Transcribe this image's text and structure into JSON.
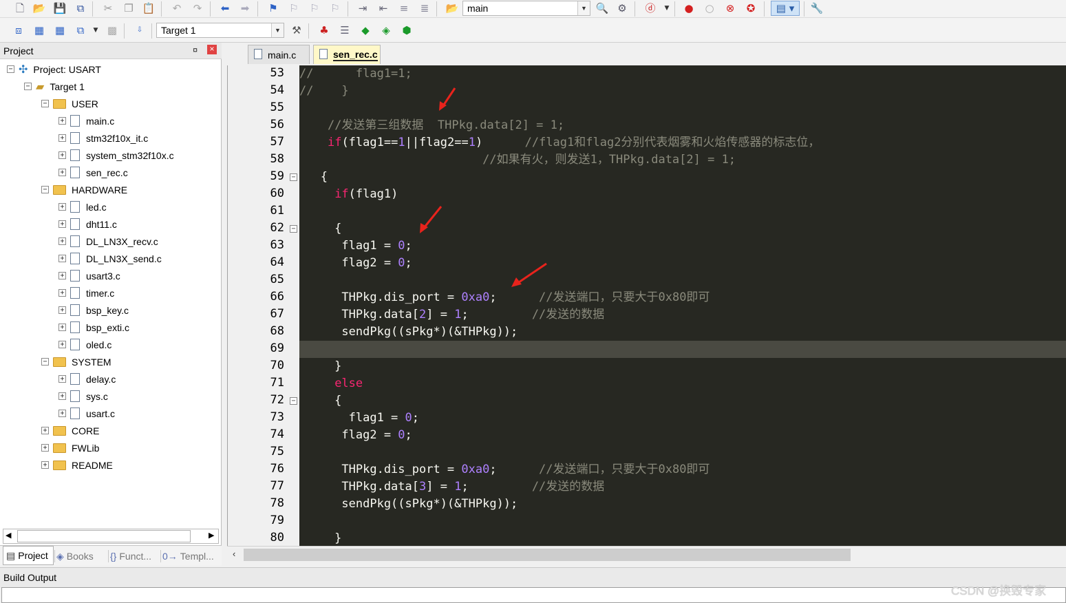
{
  "toolbar": {
    "file_combo": "main",
    "target_combo": "Target 1",
    "icons": [
      "new-file-icon",
      "open-file-icon",
      "save-icon",
      "save-all-icon",
      "cut-icon",
      "copy-icon",
      "paste-icon",
      "undo-icon",
      "redo-icon",
      "nav-back-icon",
      "nav-forward-icon",
      "bookmark-icon",
      "prev-bookmark-icon",
      "next-bookmark-icon",
      "clear-bookmarks-icon",
      "indent-icon",
      "unindent-icon",
      "comment-icon",
      "uncomment-icon",
      "find-in-files-icon",
      "find-icon",
      "incremental-find-icon",
      "debug-icon",
      "breakpoint-icon",
      "disable-breakpoint-icon",
      "disable-all-breakpoints-icon",
      "kill-breakpoints-icon",
      "window-layout-icon",
      "config-icon",
      "translate-icon",
      "build-icon",
      "rebuild-icon",
      "batch-build-icon",
      "stop-build-icon",
      "download-icon",
      "target-options-icon",
      "manage-components-icon",
      "file-extensions-icon",
      "select-pack-icon",
      "pack-installer-icon",
      "run-time-env-icon"
    ]
  },
  "project_panel": {
    "title": "Project",
    "pin": "¤",
    "close": "×",
    "root": "Project: USART",
    "target": "Target 1",
    "groups": [
      {
        "name": "USER",
        "expanded": true,
        "files": [
          "main.c",
          "stm32f10x_it.c",
          "system_stm32f10x.c",
          "sen_rec.c"
        ]
      },
      {
        "name": "HARDWARE",
        "expanded": true,
        "files": [
          "led.c",
          "dht11.c",
          "DL_LN3X_recv.c",
          "DL_LN3X_send.c",
          "usart3.c",
          "timer.c",
          "bsp_key.c",
          "bsp_exti.c",
          "oled.c"
        ]
      },
      {
        "name": "SYSTEM",
        "expanded": true,
        "files": [
          "delay.c",
          "sys.c",
          "usart.c"
        ]
      },
      {
        "name": "CORE",
        "expanded": false,
        "files": []
      },
      {
        "name": "FWLib",
        "expanded": false,
        "files": []
      },
      {
        "name": "README",
        "expanded": false,
        "files": []
      }
    ],
    "tabs": [
      "Project",
      "Books",
      "Funct...",
      "Templ..."
    ],
    "tab_glyphs": [
      "▤",
      "◈",
      "{}",
      "0→"
    ]
  },
  "editor": {
    "tabs": [
      {
        "label": "main.c",
        "active": false
      },
      {
        "label": "sen_rec.c",
        "active": true
      }
    ],
    "first_line": 53,
    "current_line": 69,
    "fold_lines": [
      59,
      62,
      72
    ],
    "lines": [
      [
        [
          "cm",
          "//      flag1=1;"
        ]
      ],
      [
        [
          "cm",
          "//    }"
        ]
      ],
      [],
      [
        [
          "",
          "    "
        ],
        [
          "cm",
          "//发送第三组数据  THPkg.data[2] = 1;"
        ]
      ],
      [
        [
          "",
          "    "
        ],
        [
          "kw",
          "if"
        ],
        [
          "",
          "(flag1=="
        ],
        [
          "num",
          "1"
        ],
        [
          "",
          "||flag2=="
        ],
        [
          "num",
          "1"
        ],
        [
          "",
          ")      "
        ],
        [
          "cm",
          "//flag1和flag2分别代表烟雾和火焰传感器的标志位，"
        ]
      ],
      [
        [
          "",
          "                          "
        ],
        [
          "cm",
          "//如果有火，则发送1，THPkg.data[2] = 1;"
        ]
      ],
      [
        [
          "",
          "   {"
        ]
      ],
      [
        [
          "",
          "     "
        ],
        [
          "kw",
          "if"
        ],
        [
          "",
          "(flag1)"
        ]
      ],
      [],
      [
        [
          "",
          "     {"
        ]
      ],
      [
        [
          "",
          "      flag1 = "
        ],
        [
          "num",
          "0"
        ],
        [
          "",
          ";"
        ]
      ],
      [
        [
          "",
          "      flag2 = "
        ],
        [
          "num",
          "0"
        ],
        [
          "",
          ";"
        ]
      ],
      [],
      [
        [
          "",
          "      THPkg.dis_port = "
        ],
        [
          "num",
          "0xa0"
        ],
        [
          "",
          ";      "
        ],
        [
          "cm",
          "//发送端口，只要大于0x80即可"
        ]
      ],
      [
        [
          "",
          "      THPkg.data["
        ],
        [
          "num",
          "2"
        ],
        [
          "",
          "] = "
        ],
        [
          "num",
          "1"
        ],
        [
          "",
          ";         "
        ],
        [
          "cm",
          "//发送的数据"
        ]
      ],
      [
        [
          "",
          "      sendPkg((sPkg*)(&THPkg));"
        ]
      ],
      [],
      [
        [
          "",
          "     }"
        ]
      ],
      [
        [
          "",
          "     "
        ],
        [
          "kw",
          "else"
        ]
      ],
      [
        [
          "",
          "     {"
        ]
      ],
      [
        [
          "",
          "       flag1 = "
        ],
        [
          "num",
          "0"
        ],
        [
          "",
          ";"
        ]
      ],
      [
        [
          "",
          "      flag2 = "
        ],
        [
          "num",
          "0"
        ],
        [
          "",
          ";"
        ]
      ],
      [],
      [
        [
          "",
          "      THPkg.dis_port = "
        ],
        [
          "num",
          "0xa0"
        ],
        [
          "",
          ";      "
        ],
        [
          "cm",
          "//发送端口，只要大于0x80即可"
        ]
      ],
      [
        [
          "",
          "      THPkg.data["
        ],
        [
          "num",
          "3"
        ],
        [
          "",
          "] = "
        ],
        [
          "num",
          "1"
        ],
        [
          "",
          ";         "
        ],
        [
          "cm",
          "//发送的数据"
        ]
      ],
      [
        [
          "",
          "      sendPkg((sPkg*)(&THPkg));"
        ]
      ],
      [],
      [
        [
          "",
          "     }"
        ]
      ]
    ]
  },
  "build_output": {
    "title": "Build Output"
  },
  "watermark": "CSDN @换毁专家",
  "colors": {
    "editor_bg": "#272822",
    "comment": "#8a8a7c",
    "keyword": "#f92672",
    "number": "#ae81ff",
    "annotation_arrow": "#e8231c"
  }
}
